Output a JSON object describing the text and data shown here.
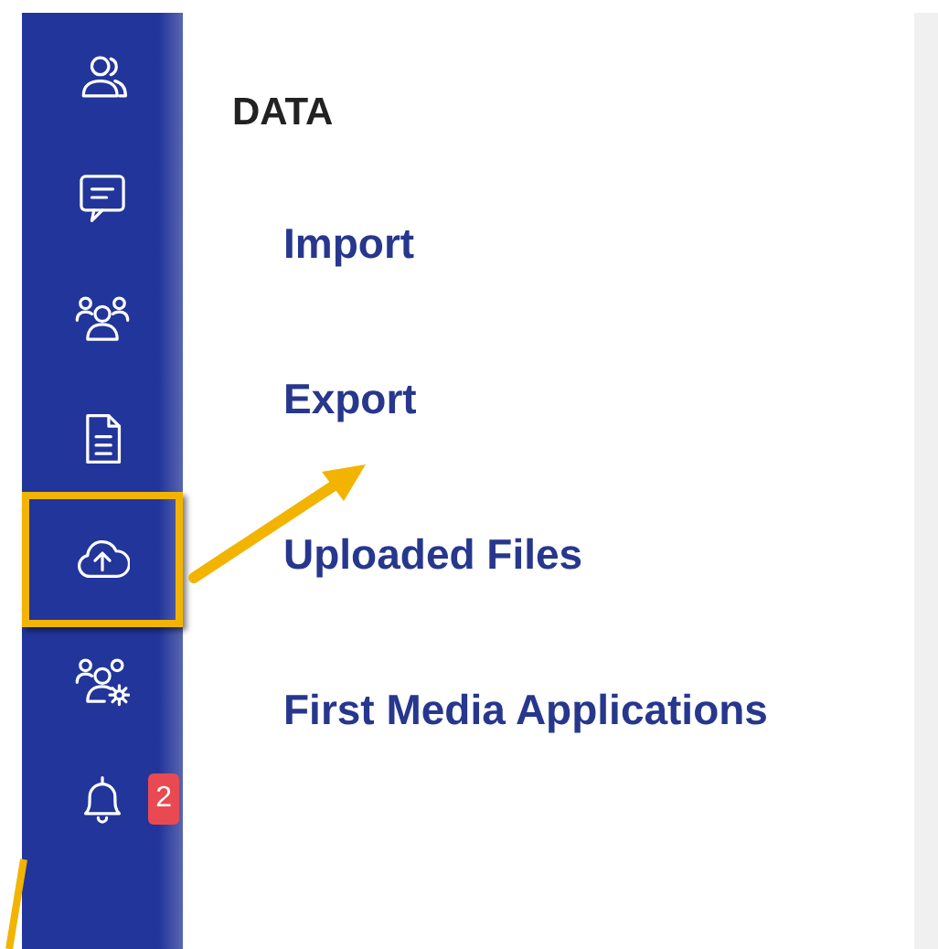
{
  "sidebar": {
    "items": [
      {
        "kind": "contacts",
        "highlighted": false
      },
      {
        "kind": "chat",
        "highlighted": false
      },
      {
        "kind": "group",
        "highlighted": false
      },
      {
        "kind": "document",
        "highlighted": false
      },
      {
        "kind": "upload",
        "highlighted": true
      },
      {
        "kind": "group-settings",
        "highlighted": false
      },
      {
        "kind": "bell",
        "highlighted": false,
        "badge": "2"
      }
    ]
  },
  "main": {
    "title": "DATA",
    "links": [
      "Import",
      "Export",
      "Uploaded Files",
      "First Media Applications"
    ]
  }
}
